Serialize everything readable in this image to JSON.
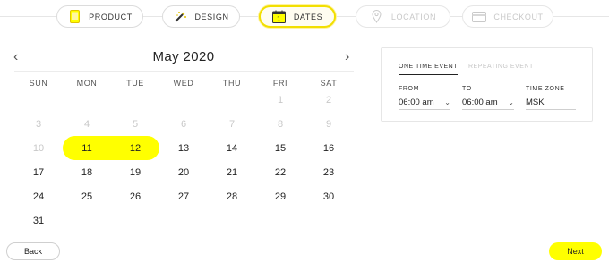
{
  "stepper": {
    "steps": [
      {
        "label": "PRODUCT",
        "icon": "phone-icon",
        "state": "done"
      },
      {
        "label": "DESIGN",
        "icon": "magic-wand-icon",
        "state": "done"
      },
      {
        "label": "DATES",
        "icon": "calendar-icon",
        "state": "active"
      },
      {
        "label": "LOCATION",
        "icon": "map-pin-icon",
        "state": "disabled"
      },
      {
        "label": "CHECKOUT",
        "icon": "credit-card-icon",
        "state": "disabled"
      }
    ]
  },
  "calendar": {
    "month_title": "May 2020",
    "prev_glyph": "‹",
    "next_glyph": "›",
    "weekdays": [
      "SUN",
      "MON",
      "TUE",
      "WED",
      "THU",
      "FRI",
      "SAT"
    ],
    "days": [
      {
        "n": "",
        "muted": true
      },
      {
        "n": "",
        "muted": true
      },
      {
        "n": "",
        "muted": true
      },
      {
        "n": "",
        "muted": true
      },
      {
        "n": "",
        "muted": true
      },
      {
        "n": "1",
        "muted": true
      },
      {
        "n": "2",
        "muted": true
      },
      {
        "n": "3",
        "muted": true
      },
      {
        "n": "4",
        "muted": true
      },
      {
        "n": "5",
        "muted": true
      },
      {
        "n": "6",
        "muted": true
      },
      {
        "n": "7",
        "muted": true
      },
      {
        "n": "8",
        "muted": true
      },
      {
        "n": "9",
        "muted": true
      },
      {
        "n": "10",
        "muted": true
      },
      {
        "n": "11",
        "muted": false,
        "selected": "start"
      },
      {
        "n": "12",
        "muted": false,
        "selected": "end"
      },
      {
        "n": "13",
        "muted": false
      },
      {
        "n": "14",
        "muted": false
      },
      {
        "n": "15",
        "muted": false
      },
      {
        "n": "16",
        "muted": false
      },
      {
        "n": "17",
        "muted": false
      },
      {
        "n": "18",
        "muted": false
      },
      {
        "n": "19",
        "muted": false
      },
      {
        "n": "20",
        "muted": false
      },
      {
        "n": "21",
        "muted": false
      },
      {
        "n": "22",
        "muted": false
      },
      {
        "n": "23",
        "muted": false
      },
      {
        "n": "24",
        "muted": false
      },
      {
        "n": "25",
        "muted": false
      },
      {
        "n": "26",
        "muted": false
      },
      {
        "n": "27",
        "muted": false
      },
      {
        "n": "28",
        "muted": false
      },
      {
        "n": "29",
        "muted": false
      },
      {
        "n": "30",
        "muted": false
      },
      {
        "n": "31",
        "muted": false
      }
    ],
    "selected_range": [
      "11",
      "12"
    ]
  },
  "event_panel": {
    "tab_one_time": "ONE TIME EVENT",
    "tab_repeating": "REPEATING EVENT",
    "active_tab": "one_time",
    "from_label": "FROM",
    "from_value": "06:00 am",
    "to_label": "TO",
    "to_value": "06:00 am",
    "timezone_label": "TIME ZONE",
    "timezone_value": "MSK"
  },
  "footer": {
    "back_label": "Back",
    "next_label": "Next"
  },
  "colors": {
    "accent": "#ffff00",
    "active_step_border": "#f2df00",
    "muted_text": "#c8c8c8"
  }
}
